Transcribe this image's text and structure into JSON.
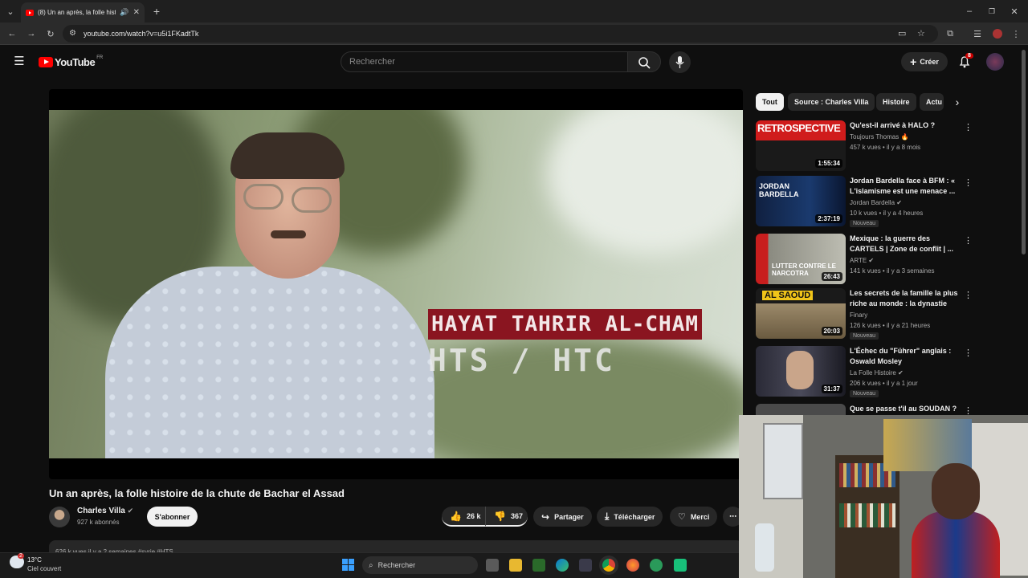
{
  "browser": {
    "tab_title": "(8) Un an après, la folle histoire",
    "url": "youtube.com/watch?v=u5i1FKadtTk"
  },
  "youtube": {
    "logo": "YouTube",
    "region": "FR",
    "search_placeholder": "Rechercher",
    "create_label": "Créer",
    "notif_count": "8"
  },
  "video": {
    "overlay_title": "HAYAT TAHRIR AL-CHAM",
    "overlay_subtitle": "HTS / HTC",
    "title": "Un an après, la folle histoire de la chute de Bachar el Assad",
    "channel": "Charles Villa",
    "subscribers": "927 k abonnés",
    "subscribe_label": "S'abonner",
    "likes": "26 k",
    "dislikes": "367",
    "share_label": "Partager",
    "download_label": "Télécharger",
    "thanks_label": "Merci",
    "description_preview": "626 k vues  il y a 2 semaines  #syrie #HTS"
  },
  "chips": [
    "Tout",
    "Source : Charles Villa",
    "Histoire",
    "Actu"
  ],
  "recommendations": [
    {
      "thumb_text": "RETROSPECTIVE",
      "duration": "1:55:34",
      "title": "Qu'est-il arrivé à HALO ?",
      "channel": "Toujours Thomas 🔥",
      "meta": "457 k vues • il y a 8 mois",
      "badge": ""
    },
    {
      "thumb_text": "JORDAN BARDELLA",
      "duration": "2:37:19",
      "title": "Jordan Bardella face à BFM : « L'islamisme est une menace ...",
      "channel": "Jordan Bardella ✔",
      "meta": "10 k vues • il y a 4 heures",
      "badge": "Nouveau"
    },
    {
      "thumb_text": "LUTTER CONTRE LE NARCOTRA",
      "duration": "26:43",
      "title": "Mexique : la guerre des CARTELS | Zone de conflit | ...",
      "channel": "ARTE ✔",
      "meta": "141 k vues • il y a 3 semaines",
      "badge": ""
    },
    {
      "thumb_text": "AL SAOUD",
      "duration": "20:03",
      "title": "Les secrets de la famille la plus riche au monde : la dynastie Al...",
      "channel": "Finary",
      "meta": "126 k vues • il y a 21 heures",
      "badge": "Nouveau"
    },
    {
      "thumb_text": "",
      "duration": "31:37",
      "title": "L'Échec du \"Führer\" anglais : Oswald Mosley",
      "channel": "La Folle Histoire ✔",
      "meta": "206 k vues • il y a 1 jour",
      "badge": "Nouveau"
    },
    {
      "thumb_text": "",
      "duration": "",
      "title": "Que se passe t'il au SOUDAN ?",
      "channel": "",
      "meta": "",
      "badge": ""
    }
  ],
  "taskbar": {
    "temperature": "13°C",
    "weather": "Ciel couvert",
    "weather_badge": "2",
    "search_label": "Rechercher"
  },
  "colors": {
    "youtube_red": "#ff0000",
    "bg": "#0f0f0f",
    "lower_third": "#8a1520"
  }
}
